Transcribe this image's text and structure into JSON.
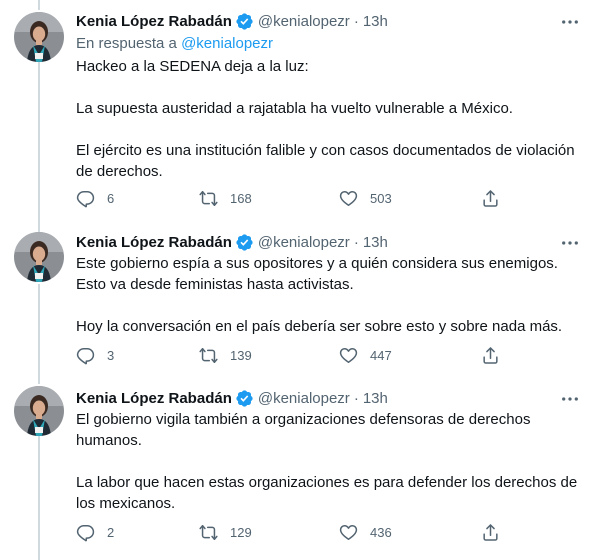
{
  "author": {
    "name": "Kenia López Rabadán",
    "handle": "@kenialopezr",
    "time": "13h",
    "separator": "·"
  },
  "colors": {
    "text": "#0f1419",
    "secondary": "#536471",
    "link": "#1d9bf0",
    "verified": "#1d9bf0",
    "thread_line": "#cfd9de"
  },
  "tweets": [
    {
      "reply_prefix": "En respuesta a",
      "reply_to": "@kenialopezr",
      "paragraphs": [
        "Hackeo a la SEDENA deja a la luz:",
        "La supuesta austeridad a rajatabla ha vuelto vulnerable a México.",
        "El ejército es una institución falible y con casos documentados de violación\nde derechos."
      ],
      "replies": "6",
      "retweets": "168",
      "likes": "503"
    },
    {
      "paragraphs": [
        "Este gobierno espía a sus opositores y a quién considera sus enemigos.\nEsto va desde feministas hasta activistas.",
        "Hoy la conversación en el país debería ser sobre esto y sobre nada más."
      ],
      "replies": "3",
      "retweets": "139",
      "likes": "447"
    },
    {
      "paragraphs": [
        "El gobierno vigila también a organizaciones defensoras de derechos\nhumanos.",
        "La labor que hacen estas organizaciones es para defender los derechos de\nlos mexicanos."
      ],
      "replies": "2",
      "retweets": "129",
      "likes": "436"
    }
  ],
  "icons": {
    "verified": "verified-badge-icon",
    "more": "more-options-icon",
    "reply": "reply-icon",
    "retweet": "retweet-icon",
    "like": "heart-icon",
    "share": "share-icon"
  }
}
